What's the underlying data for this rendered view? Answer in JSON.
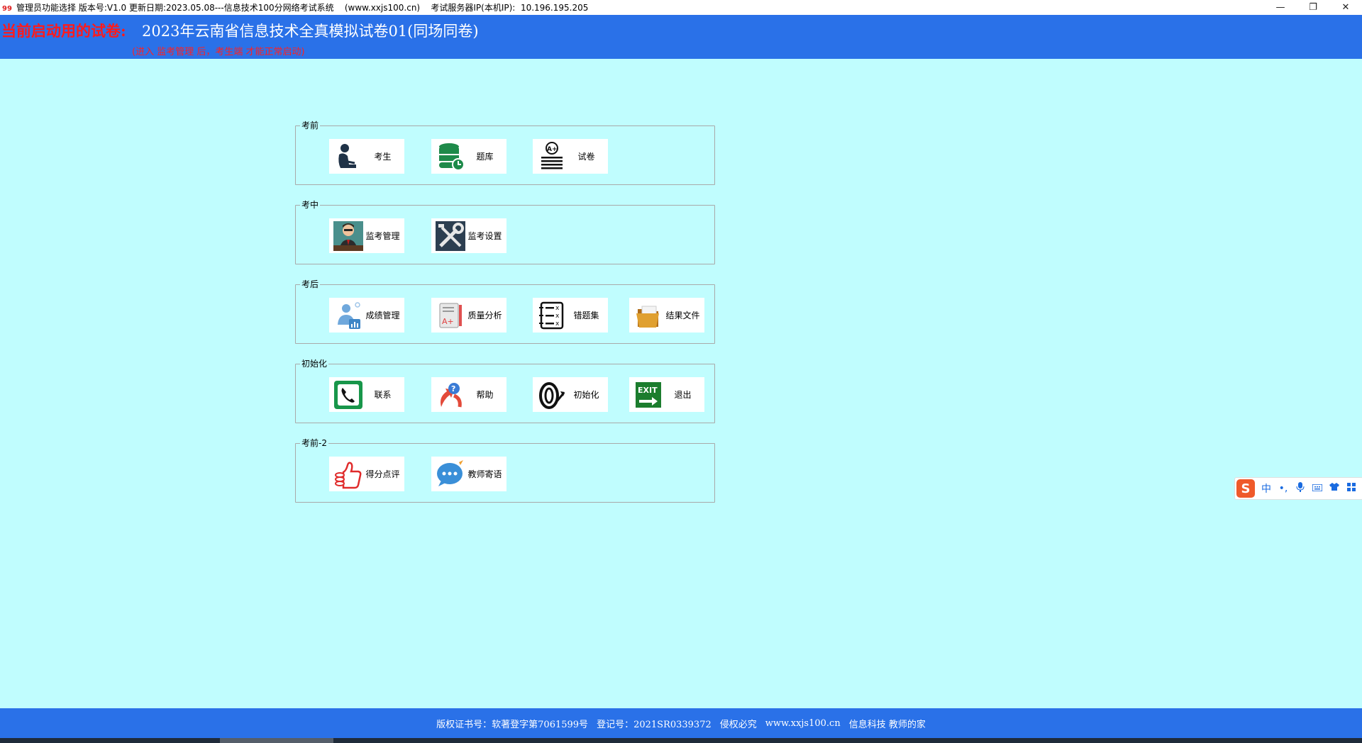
{
  "window": {
    "title": "管理员功能选择 版本号:V1.0 更新日期:2023.05.08---信息技术100分网络考试系统    (www.xxjs100.cn)    考试服务器IP(本机IP):  10.196.195.205",
    "minimize": "—",
    "restore": "❐",
    "close": "✕"
  },
  "header": {
    "label": "当前启动用的试卷:",
    "exam_name": "2023年云南省信息技术全真模拟试卷01(同场同卷)",
    "note": "(进入 监考管理 后，考生端 才能正常启动)"
  },
  "groups": [
    {
      "title": "考前",
      "tiles": [
        {
          "label": "考生",
          "icon": "student-icon"
        },
        {
          "label": "题库",
          "icon": "database-icon"
        },
        {
          "label": "试卷",
          "icon": "exam-paper-icon"
        }
      ]
    },
    {
      "title": "考中",
      "tiles": [
        {
          "label": "监考管理",
          "icon": "proctor-icon"
        },
        {
          "label": "监考设置",
          "icon": "tools-icon"
        }
      ]
    },
    {
      "title": "考后",
      "tiles": [
        {
          "label": "成绩管理",
          "icon": "score-management-icon"
        },
        {
          "label": "质量分析",
          "icon": "quality-analysis-icon"
        },
        {
          "label": "错题集",
          "icon": "wrong-questions-icon"
        },
        {
          "label": "结果文件",
          "icon": "folder-icon"
        }
      ]
    },
    {
      "title": "初始化",
      "tiles": [
        {
          "label": "联系",
          "icon": "phone-icon"
        },
        {
          "label": "帮助",
          "icon": "help-icon"
        },
        {
          "label": "初始化",
          "icon": "initialize-icon"
        },
        {
          "label": "退出",
          "icon": "exit-icon"
        }
      ]
    },
    {
      "title": "考前-2",
      "tiles": [
        {
          "label": "得分点评",
          "icon": "thumbs-up-icon"
        },
        {
          "label": "教师寄语",
          "icon": "chat-bubble-icon"
        }
      ]
    }
  ],
  "footer": {
    "copyright": "版权证书号：软著登字第7061599号",
    "registration": "登记号：2021SR0339372",
    "rights": "侵权必究",
    "website": "www.xxjs100.cn",
    "company": "信息科技 教师的家"
  },
  "ime": {
    "logo": "S",
    "mode": "中",
    "punct": "•,"
  },
  "colors": {
    "header_bg": "#2a71e8",
    "page_bg": "#c0fdfe",
    "label_red": "#ff1a1a"
  }
}
